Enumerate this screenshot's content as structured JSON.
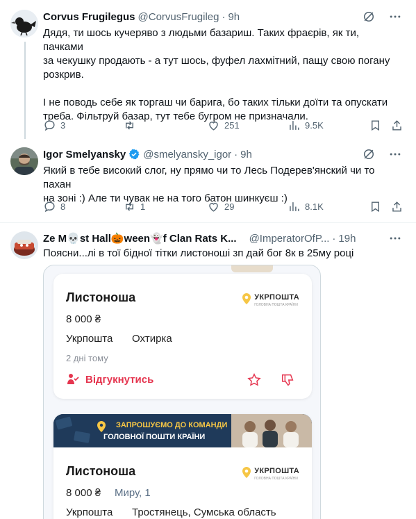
{
  "tweets": [
    {
      "name": "Corvus Frugilegus",
      "handle": "@CorvusFrugileg",
      "time": "9h",
      "text": [
        "Дядя, ти шось кучеряво з людьми базариш. Таких фраєрів, як ти, пачками",
        "за чекушку продають - а тут шось, фуфел лахмітний, пащу свою погану",
        "розкрив.",
        "",
        "І не поводь себе як торгаш чи барига, бо таких тільки доїти та опускати",
        "треба. Фільтруй базар, тут тебе бугром не призначали."
      ],
      "replies": "3",
      "reposts": "",
      "likes": "251",
      "views": "9.5K"
    },
    {
      "name": "Igor Smelyansky",
      "handle": "@smelyansky_igor",
      "time": "9h",
      "text": [
        "Який в тебе високий слог, ну прямо чи то Лесь Подерев'янский чи то пахан",
        "на зоні :) Але ти чувак не на того батон шинкуєш :)"
      ],
      "replies": "8",
      "reposts": "1",
      "likes": "29",
      "views": "8.1K"
    },
    {
      "name": "Ze M💀st Hall🎃ween👻f Clan Rats K...",
      "handle": "@ImperatorOfP...",
      "time": "19h",
      "text": [
        "Поясни...лі в тої бідної тітки листоноші зп дай бог 8к в 25му році"
      ]
    }
  ],
  "job_cards": [
    {
      "title": "Листоноша",
      "salary": "8 000 ₴",
      "company": "Укрпошта",
      "city": "Охтирка",
      "posted": "2 дні тому",
      "respond": "Відгукнутись",
      "logo": "УКРПОШТА",
      "logo_sub": "ГОЛОВНА ПОШТА КРАЇНИ"
    },
    {
      "banner_line1": "ЗАПРОШУЄМО ДО КОМАНДИ",
      "banner_line2": "ГОЛОВНОЇ ПОШТИ КРАЇНИ",
      "title": "Листоноша",
      "salary": "8 000 ₴",
      "extra": "Миру, 1",
      "company": "Укрпошта",
      "city": "Тростянець, Сумська область",
      "logo": "УКРПОШТА",
      "logo_sub": "ГОЛОВНА ПОШТА КРАЇНИ"
    }
  ],
  "colors": {
    "text": "#0f1419",
    "muted": "#536471",
    "divider": "#eff3f4",
    "verified": "#1d9bf0",
    "respond": "#e5354f",
    "ukrposhta_yellow": "#f6c645"
  },
  "icons": [
    "grok-icon",
    "more-icon",
    "reply-icon",
    "repost-icon",
    "like-icon",
    "views-icon",
    "bookmark-icon",
    "share-icon",
    "verified-icon",
    "respond-person-icon",
    "star-icon",
    "dislike-icon",
    "ukrposhta-logo-icon"
  ]
}
